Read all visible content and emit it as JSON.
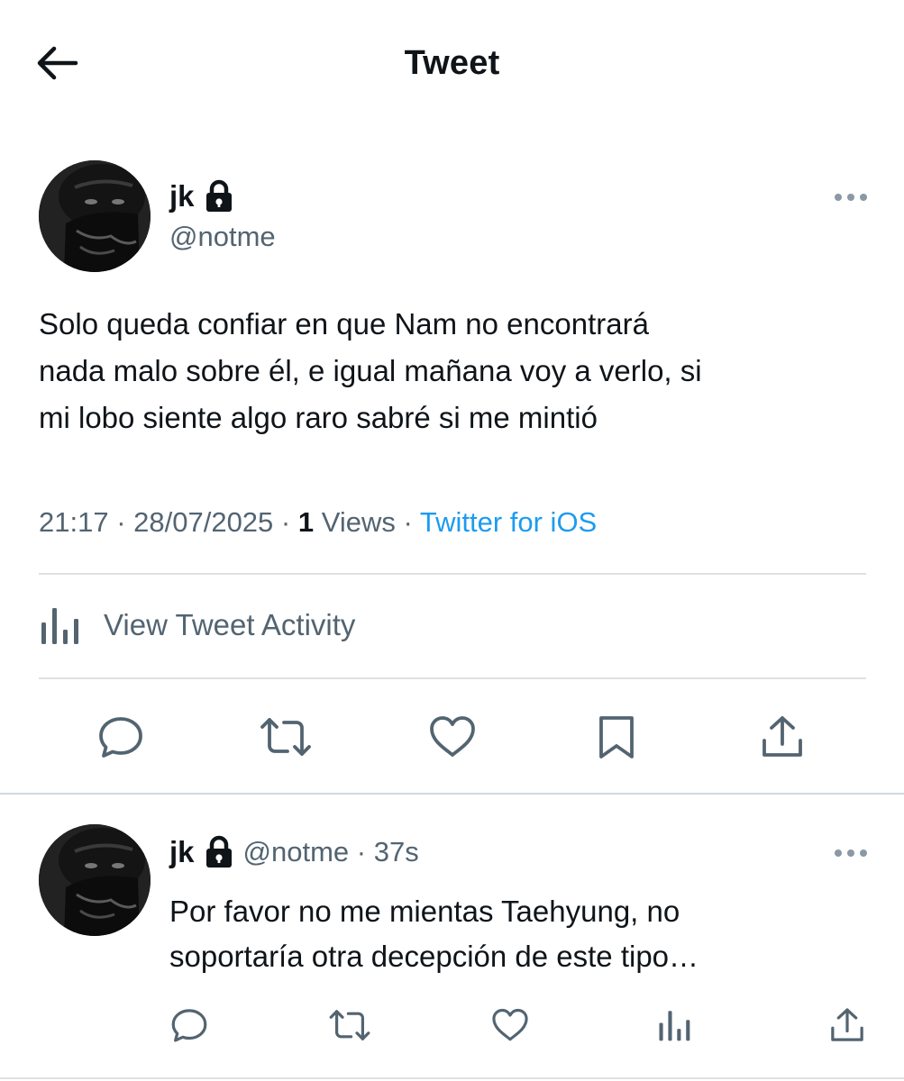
{
  "header": {
    "title": "Tweet",
    "back_icon": "arrow-left-icon"
  },
  "tweet": {
    "display_name": "jk",
    "handle": "@notme",
    "protected_icon": "lock-icon",
    "text": "Solo queda confiar en que Nam no encontrará\nnada malo sobre él, e igual mañana voy a verlo, si\nmi lobo siente algo raro sabré si me mintió",
    "time": "21:17",
    "sep1": " · ",
    "date": "28/07/2025",
    "sep2": " · ",
    "views_count": "1",
    "views_label": " Views",
    "sep3": " · ",
    "source": "Twitter for iOS",
    "activity_label": "View Tweet Activity",
    "actions": [
      "reply-icon",
      "retweet-icon",
      "like-icon",
      "bookmark-icon",
      "share-icon"
    ]
  },
  "reply": {
    "display_name": "jk",
    "handle": "@notme",
    "separator": " · ",
    "time_ago": "37s",
    "text": "Por favor no me mientas Taehyung, no\nsoportaría otra decepción de este tipo…",
    "actions": [
      "reply-icon",
      "retweet-icon",
      "like-icon",
      "views-icon",
      "share-icon"
    ]
  },
  "colors": {
    "text_primary": "#0f1419",
    "text_secondary": "#536471",
    "link": "#1d9bf0",
    "divider": "#dde1e4",
    "icon": "#536471"
  }
}
